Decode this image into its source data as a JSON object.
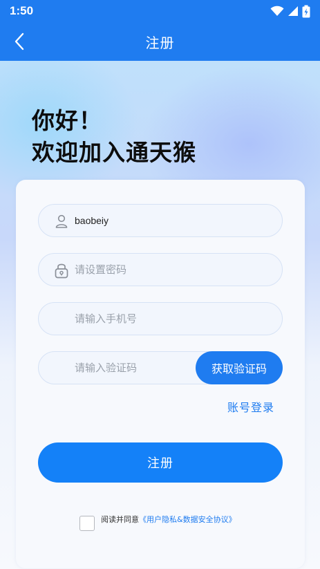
{
  "status_bar": {
    "time": "1:50"
  },
  "nav": {
    "title": "注册"
  },
  "greeting": {
    "line1": "你好！",
    "line2": "欢迎加入通天猴"
  },
  "form": {
    "username_value": "baobeiy",
    "password_placeholder": "请设置密码",
    "phone_placeholder": "请输入手机号",
    "code_placeholder": "请输入验证码",
    "get_code_label": "获取验证码",
    "login_link": "账号登录",
    "register_label": "注册"
  },
  "agreement": {
    "text": "阅读并同意",
    "link": "《用户隐私&数据安全协议》",
    "checked": false
  },
  "colors": {
    "primary": "#1f7cf0",
    "button": "#1481f8"
  }
}
